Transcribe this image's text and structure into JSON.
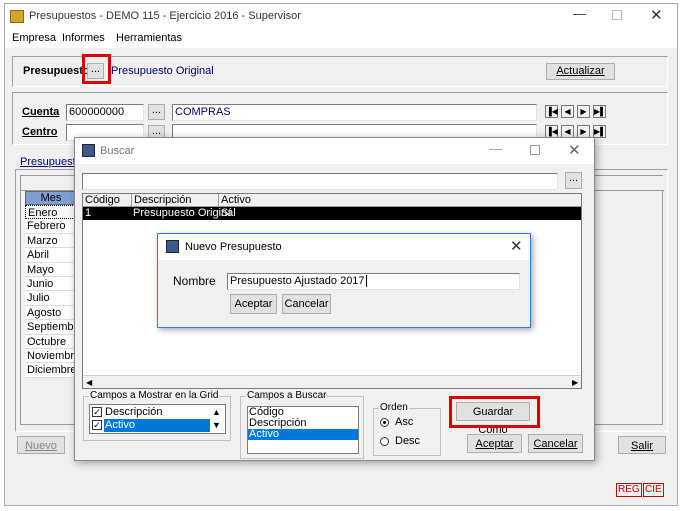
{
  "main_window": {
    "title": "Presupuestos - DEMO 115 - Ejercicio 2016 - Supervisor",
    "menu": [
      "Empresa",
      "Informes",
      "Herramientas"
    ],
    "presupuesto_label": "Presupuesto",
    "presupuesto_value": "Presupuesto Original",
    "actualizar_label": "Actualizar",
    "cuenta_label": "Cuenta",
    "cuenta_value": "600000000",
    "cuenta_desc": "COMPRAS",
    "centro_label": "Centro",
    "centro_value": "",
    "tab_label": "Presupuesto",
    "mes_header": "Mes",
    "months": [
      "Enero",
      "Febrero",
      "Marzo",
      "Abril",
      "Mayo",
      "Junio",
      "Julio",
      "Agosto",
      "Septiembre",
      "Octubre",
      "Noviembre",
      "Diciembre"
    ],
    "nuevo_label": "Nuevo",
    "salir_label": "Salir",
    "status": [
      "REG",
      "CIE"
    ]
  },
  "buscar_dialog": {
    "title": "Buscar",
    "search_value": "",
    "columns": [
      "Código",
      "Descripción",
      "Activo"
    ],
    "rows": [
      [
        "1",
        "Presupuesto Original",
        "Sí"
      ]
    ],
    "campos_mostrar_label": "Campos a Mostrar en la Grid",
    "campos_mostrar": [
      {
        "label": "Descripción",
        "checked": true
      },
      {
        "label": "Activo",
        "checked": true
      }
    ],
    "campos_buscar_label": "Campos a Buscar",
    "campos_buscar": [
      "Código",
      "Descripción",
      "Activo"
    ],
    "orden_label": "Orden",
    "orden_options": [
      "Asc",
      "Desc"
    ],
    "orden_selected": "Asc",
    "guardar_como_label": "Guardar Como",
    "aceptar_label": "Aceptar",
    "cancelar_label": "Cancelar"
  },
  "nuevo_dialog": {
    "title": "Nuevo Presupuesto",
    "nombre_label": "Nombre",
    "nombre_value": "Presupuesto Ajustado 2017",
    "aceptar_label": "Aceptar",
    "cancelar_label": "Cancelar"
  },
  "colors": {
    "highlight": "#0078d7",
    "red_annotation": "#e00000",
    "selected_row": "#000000"
  }
}
